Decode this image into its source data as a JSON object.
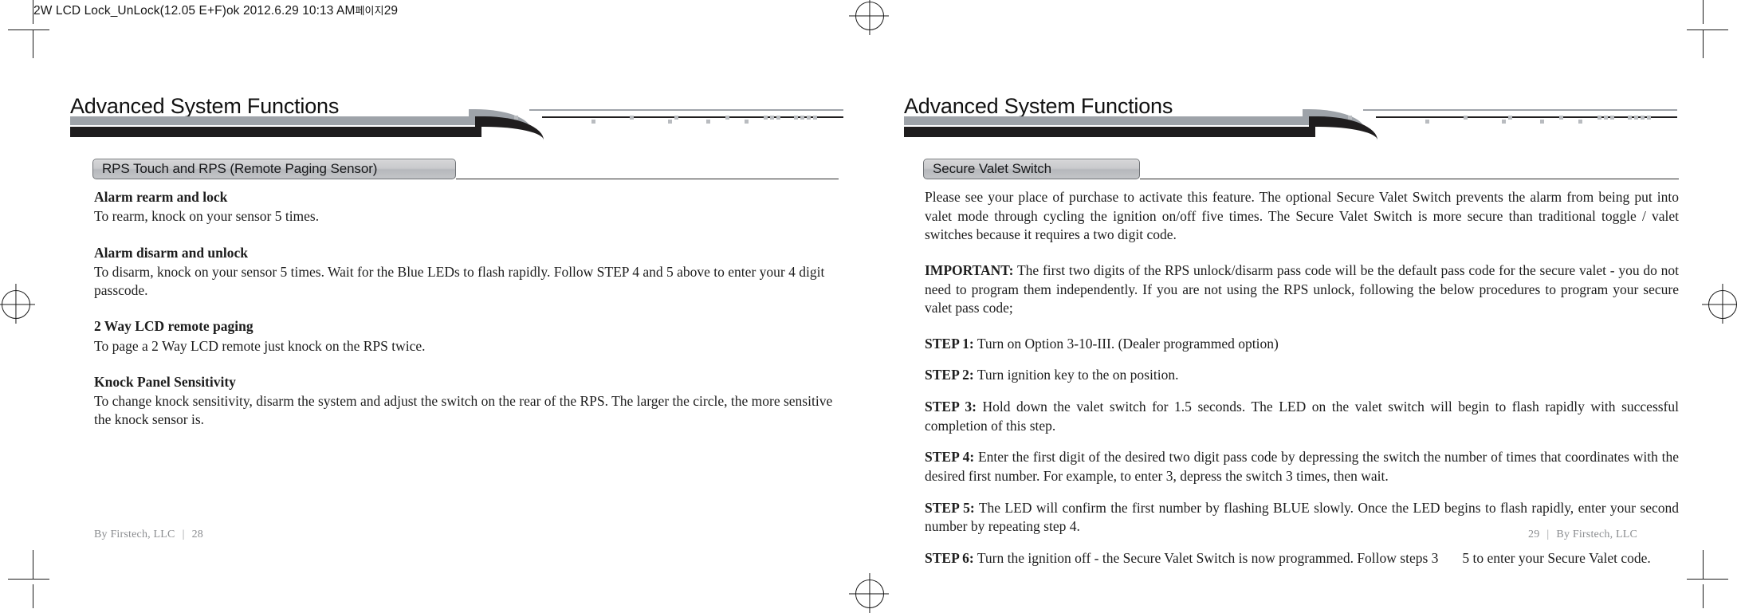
{
  "slug": {
    "text": "2W LCD Lock_UnLock(12.05 E+F)ok  2012.6.29 10:13 AM",
    "korean": "페이지",
    "page_number": "29"
  },
  "left_page": {
    "running_head": "Advanced System Functions",
    "section_title": "RPS Touch and RPS (Remote Paging Sensor)",
    "blocks": [
      {
        "heading": "Alarm rearm and lock",
        "body": "To rearm, knock on your sensor 5 times."
      },
      {
        "heading": "Alarm disarm and unlock",
        "body": "To disarm, knock on your sensor 5 times. Wait for the Blue LEDs to flash rapidly. Follow STEP 4 and 5 above to enter your 4 digit passcode."
      },
      {
        "heading": "2 Way LCD remote paging",
        "body": "To page a 2 Way LCD remote just knock on the RPS twice."
      },
      {
        "heading": "Knock Panel Sensitivity",
        "body": "To change knock sensitivity, disarm the system and adjust the switch on the rear of the RPS. The larger the circle, the more sensitive the knock sensor is."
      }
    ],
    "footer": {
      "imprint": "By Firstech, LLC",
      "separator": "|",
      "page_number": "28"
    }
  },
  "right_page": {
    "running_head": "Advanced System Functions",
    "section_title": "Secure Valet Switch",
    "intro": "Please see your place of purchase to activate this feature. The optional Secure Valet Switch prevents the alarm from being put into valet mode through cycling the ignition on/off five times. The Secure Valet Switch is more secure than traditional toggle / valet switches because it requires a two digit code.",
    "important_label": "IMPORTANT:",
    "important_body": "The first two digits of the RPS unlock/disarm pass code will be the default pass code for the secure valet - you do not need to program them independently. If you are not using the RPS unlock, following the below procedures to program your secure valet pass code;",
    "steps": [
      {
        "label": "STEP 1:",
        "body": "Turn on Option 3-10-III. (Dealer programmed option)"
      },
      {
        "label": "STEP 2:",
        "body": "Turn ignition key to the  on  position."
      },
      {
        "label": "STEP 3:",
        "body": "Hold down the valet switch for 1.5 seconds. The LED on the valet switch will begin to flash rapidly with successful completion of this step."
      },
      {
        "label": "STEP 4:",
        "body": "Enter the first digit of the desired two digit pass code by depressing the switch the number of times that coordinates with the desired first number. For example, to enter 3, depress the switch 3 times, then wait."
      },
      {
        "label": "STEP 5:",
        "body": "The LED will confirm the first number by flashing BLUE slowly. Once the LED begins to flash rapidly, enter your second number by repeating step 4."
      },
      {
        "label": "STEP 6:",
        "body_before_gap": "Turn the ignition off - the Secure Valet Switch is now programmed. Follow steps 3",
        "body_after_gap": "5 to enter your Secure Valet code."
      }
    ],
    "footer": {
      "page_number": "29",
      "separator": "|",
      "imprint": "By Firstech, LLC"
    }
  },
  "colors": {
    "swoosh_gray": "#9ea3a9",
    "swoosh_black": "#1f1d1e",
    "section_bar": "#c5c7ca",
    "footer_text": "#8b8d90"
  }
}
